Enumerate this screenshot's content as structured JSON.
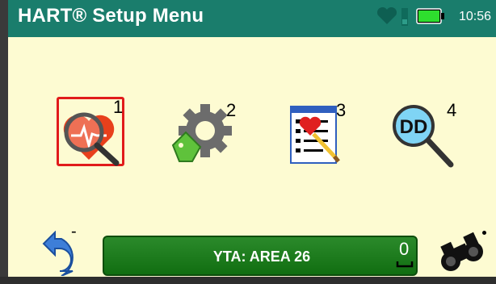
{
  "header": {
    "title": "HART® Setup Menu",
    "time": "10:56",
    "battery_level": 1.0,
    "color": "#1a7d6c"
  },
  "menu": {
    "items": [
      {
        "number": "1",
        "icon": "heart-magnifier-icon",
        "selected": true
      },
      {
        "number": "2",
        "icon": "gear-tag-icon",
        "selected": false
      },
      {
        "number": "3",
        "icon": "checklist-heart-icon",
        "selected": false
      },
      {
        "number": "4",
        "icon": "dd-magnifier-icon",
        "selected": false
      }
    ]
  },
  "footer": {
    "back_label": "-",
    "status_text": "YTA: AREA 26",
    "status_count": "0",
    "status_color": "#1f7f1f"
  }
}
